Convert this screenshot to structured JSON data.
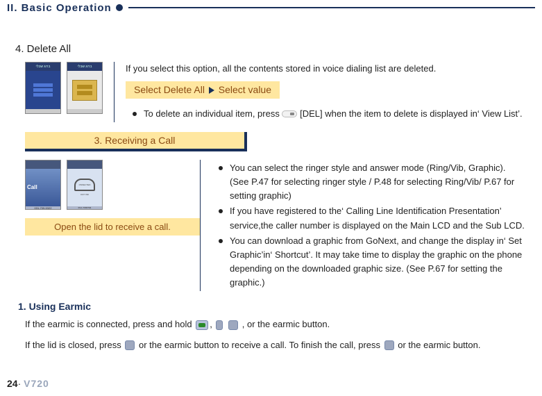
{
  "header": {
    "title": "II. Basic Operation"
  },
  "section4": {
    "heading": "4. Delete All",
    "intro": "If you select this option, all the contents stored in voice dialing list are deleted.",
    "highlight_pre": "Select Delete All",
    "highlight_post": "Select value",
    "bullet1_a": "To delete an individual item, press ",
    "bullet1_b": " [DEL] when the item to delete is displayed in‘ View List’.",
    "thumb1_top": "ברוג שבלי",
    "thumb2_top": "ברוג שבלי"
  },
  "section3": {
    "title": "3. Receiving a Call"
  },
  "ringer": {
    "b1": "You can select the ringer style and answer mode (Ring/Vib, Graphic). (See P.47 for selecting ringer style / P.48 for selecting Ring/Vib/ P.67 for setting graphic)",
    "b2": "If you have registered to the‘ Calling Line Identification Presentation’ service,the caller number is displayed on the Main LCD and the Sub LCD.",
    "b3": "You can download a graphic from GoNext, and change the display in‘ Set Graphic’in‘ Shortcut’. It may take time to display the graphic on the phone depending on the downloaded graphic size. (See P.67 for setting the graphic.)",
    "caption": "Open the lid to receive a call.",
    "thumbA_call": "Call",
    "thumbA_foot": "031-709-5322",
    "thumbB_arc": "ONNECTED",
    "thumbB_foot1": "0:07    720",
    "thumbB_foot2": "03-1-7093704"
  },
  "earmic": {
    "heading": "1. Using Earmic",
    "p1a": "If the earmic is connected, press and hold ",
    "p1b": ", or the earmic button.",
    "p2a": "If the lid is closed, press ",
    "p2b": " or the earmic button to receive a call. To finish the call, press ",
    "p2c": " or the earmic button."
  },
  "footer": {
    "page": "24",
    "model": "V720"
  }
}
